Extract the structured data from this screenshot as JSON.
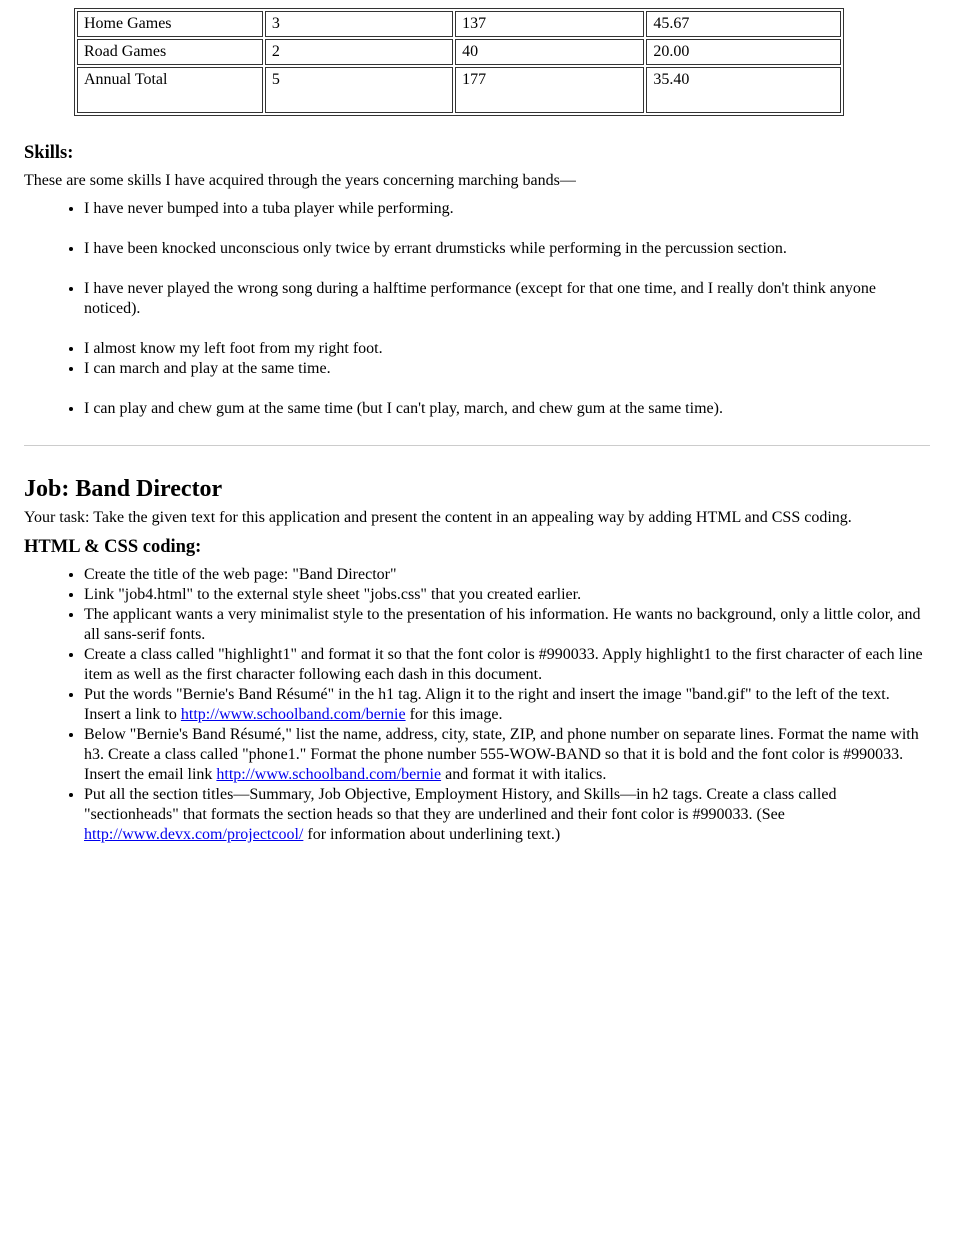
{
  "table": {
    "rows": [
      [
        "Home Games",
        "3",
        "137",
        "45.67"
      ],
      [
        "Road Games",
        "2",
        "40",
        "20.00"
      ],
      [
        "Annual Total",
        "5",
        "177",
        "35.40"
      ]
    ]
  },
  "prev_heading": "Skills:",
  "prev_intro": "These are some skills I have acquired through the years concerning marching bands—",
  "skills": [
    "I have never bumped into a tuba player while performing.",
    "I have been knocked unconscious only twice by errant drumsticks while performing in the percussion section.",
    "I have never played the wrong song during a halftime performance (except for that one time, and I really don't think anyone noticed).",
    "I almost know my left foot from my right foot.",
    "I can march and play at the same time.",
    "I can play and chew gum at the same time (but I can't play, march, and chew gum at the same time)."
  ],
  "job": {
    "heading": "Job: Band Director",
    "task": "Your task: Take the given text for this application and present the content in an appealing way by adding HTML and CSS coding.",
    "heading2": "HTML & CSS coding:",
    "bullets": [
      {
        "text": "Create the title of the web page: \"Band Director\""
      },
      {
        "text": "Link \"job4.html\" to the external style sheet \"jobs.css\" that you created earlier."
      },
      {
        "text": "The applicant wants a very minimalist style to the presentation of his information. He wants no background, only a little color, and all sans-serif fonts."
      },
      {
        "text": "Create a class called \"highlight1\" and format it so that the font color is #990033. Apply highlight1 to the first character of each line item as well as the first character following each dash in this document."
      },
      {
        "text": "Put the words \"Bernie's Band Résumé\" in the h1 tag. Align it to the right and insert the image \"band.gif\" to the left of the text. Insert a link to ",
        "link_text": "http://www.schoolband.com/bernie",
        "text_after": " for this image."
      },
      {
        "text": "Below \"Bernie's Band Résumé,\" list the name, address, city, state, ZIP, and phone number on separate lines. Format the name with h3. Create a class called \"phone1.\" Format the phone number 555-WOW-BAND so that it is bold and the font color is #990033. Insert the email link ",
        "link_text": "http://www.schoolband.com/bernie",
        "text_after": " and format it with italics."
      },
      {
        "text": "Put all the section titles—Summary, Job Objective, Employment History, and Skills—in h2 tags. Create a class called \"sectionheads\" that formats the section heads so that they are underlined and their font color is #990033. (See ",
        "link_text": "http://www.devx.com/projectcool/",
        "text_after": " for information about underlining text.)"
      }
    ]
  }
}
